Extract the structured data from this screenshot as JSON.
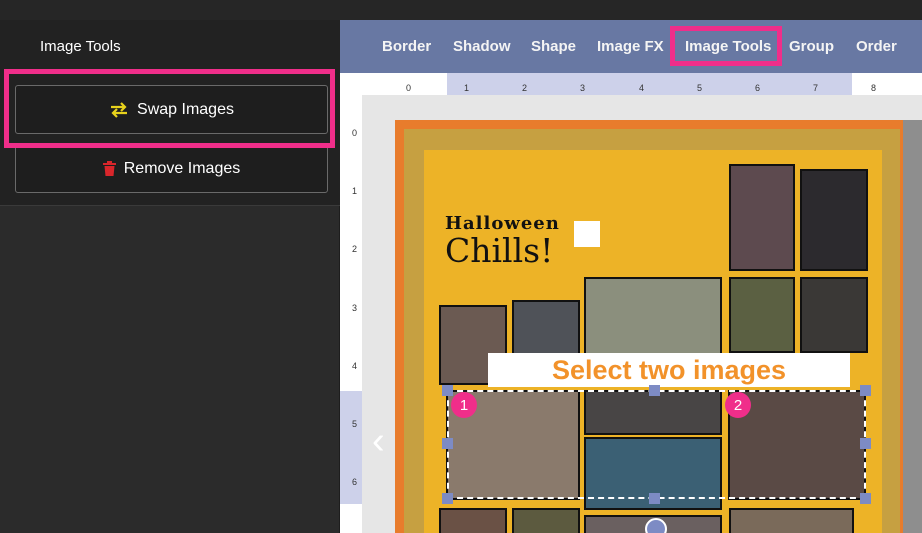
{
  "sidebar": {
    "title": "Image Tools",
    "swap_label": "Swap Images",
    "remove_label": "Remove Images"
  },
  "toolbar": {
    "tabs": [
      "Border",
      "Shadow",
      "Shape",
      "Image FX",
      "Image Tools",
      "Group",
      "Order"
    ],
    "active_tab": "Image Tools"
  },
  "ruler": {
    "h_numbers": [
      "0",
      "1",
      "2",
      "3",
      "4",
      "5",
      "6",
      "7",
      "8"
    ],
    "v_numbers": [
      "0",
      "1",
      "2",
      "3",
      "4",
      "5",
      "6"
    ]
  },
  "canvas": {
    "title_line1": "Halloween",
    "title_line2": "Chills!",
    "banner": "Select two images",
    "badge_1": "1",
    "badge_2": "2"
  },
  "colors": {
    "highlight": "#f02e8a",
    "toolbar": "#6878a3",
    "page_yellow": "#edb327",
    "page_orange": "#e87c2c",
    "banner_text": "#f2922a",
    "swap_icon": "#e8d21c",
    "trash_icon": "#d9262b"
  },
  "icons": {
    "swap": "swap-arrows-icon",
    "remove": "trash-icon",
    "prev": "chevron-left-icon",
    "rotate": "rotate-icon"
  }
}
